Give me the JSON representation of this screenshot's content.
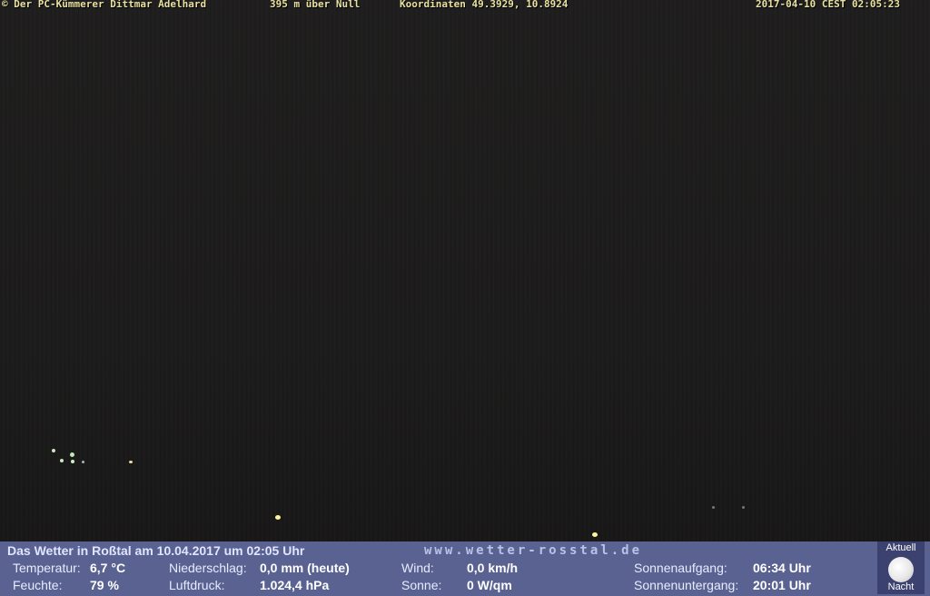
{
  "overlay": {
    "credit": "© Der PC-Kümmerer Dittmar Adelhard",
    "altitude": "395 m über Null",
    "coords": "Koordinaten 49.3929, 10.8924",
    "timestamp": "2017-04-10 CEST 02:05:23"
  },
  "weather": {
    "title": "Das Wetter in Roßtal am 10.04.2017 um 02:05 Uhr",
    "site": "www.wetter-rosstal.de",
    "temp_label": "Temperatur:",
    "temp_value": "6,7 °C",
    "humidity_label": "Feuchte:",
    "humidity_value": "79 %",
    "precip_label": "Niederschlag:",
    "precip_value": "0,0 mm (heute)",
    "pressure_label": "Luftdruck:",
    "pressure_value": "1.024,4 hPa",
    "wind_label": "Wind:",
    "wind_value": "0,0 km/h",
    "sun_label": "Sonne:",
    "sun_value": "0 W/qm",
    "sunrise_label": "Sonnenaufgang:",
    "sunrise_value": "06:34 Uhr",
    "sunset_label": "Sonnenuntergang:",
    "sunset_value": "20:01 Uhr",
    "moon_top": "Aktuell",
    "moon_bottom": "Nacht"
  }
}
